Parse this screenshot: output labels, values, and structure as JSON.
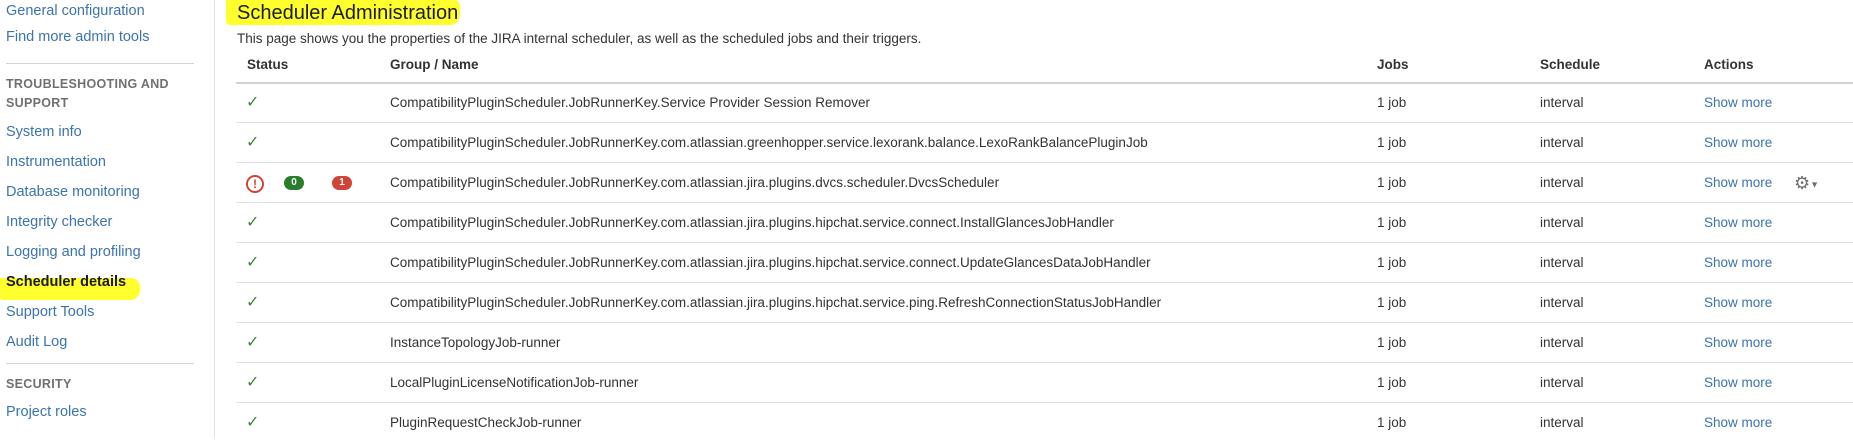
{
  "sidebar": {
    "top_links": [
      "General configuration",
      "Find more admin tools"
    ],
    "troubleshooting_heading_line1": "TROUBLESHOOTING AND",
    "troubleshooting_heading_line2": "SUPPORT",
    "troubleshooting_items": [
      "System info",
      "Instrumentation",
      "Database monitoring",
      "Integrity checker",
      "Logging and profiling",
      "Scheduler details",
      "Support Tools",
      "Audit Log"
    ],
    "security_heading": "SECURITY",
    "security_items": [
      "Project roles"
    ],
    "highlight_color": "#ffff2e"
  },
  "page": {
    "title": "Scheduler Administration",
    "description": "This page shows you the properties of the JIRA internal scheduler, as well as the scheduled jobs and their triggers."
  },
  "table": {
    "headers": {
      "status": "Status",
      "name": "Group / Name",
      "jobs": "Jobs",
      "schedule": "Schedule",
      "actions": "Actions"
    },
    "rows": [
      {
        "status": "ok",
        "name": "CompatibilityPluginScheduler.JobRunnerKey.Service Provider Session Remover",
        "jobs": "1 job",
        "schedule": "interval",
        "action": "Show more"
      },
      {
        "status": "ok",
        "name": "CompatibilityPluginScheduler.JobRunnerKey.com.atlassian.greenhopper.service.lexorank.balance.LexoRankBalancePluginJob",
        "jobs": "1 job",
        "schedule": "interval",
        "action": "Show more"
      },
      {
        "status": "error",
        "success_count": "0",
        "failure_count": "1",
        "name": "CompatibilityPluginScheduler.JobRunnerKey.com.atlassian.jira.plugins.dvcs.scheduler.DvcsScheduler",
        "jobs": "1 job",
        "schedule": "interval",
        "action": "Show more",
        "has_gear_menu": true
      },
      {
        "status": "ok",
        "name": "CompatibilityPluginScheduler.JobRunnerKey.com.atlassian.jira.plugins.hipchat.service.connect.InstallGlancesJobHandler",
        "jobs": "1 job",
        "schedule": "interval",
        "action": "Show more"
      },
      {
        "status": "ok",
        "name": "CompatibilityPluginScheduler.JobRunnerKey.com.atlassian.jira.plugins.hipchat.service.connect.UpdateGlancesDataJobHandler",
        "jobs": "1 job",
        "schedule": "interval",
        "action": "Show more"
      },
      {
        "status": "ok",
        "name": "CompatibilityPluginScheduler.JobRunnerKey.com.atlassian.jira.plugins.hipchat.service.ping.RefreshConnectionStatusJobHandler",
        "jobs": "1 job",
        "schedule": "interval",
        "action": "Show more"
      },
      {
        "status": "ok",
        "name": "InstanceTopologyJob-runner",
        "jobs": "1 job",
        "schedule": "interval",
        "action": "Show more"
      },
      {
        "status": "ok",
        "name": "LocalPluginLicenseNotificationJob-runner",
        "jobs": "1 job",
        "schedule": "interval",
        "action": "Show more"
      },
      {
        "status": "ok",
        "name": "PluginRequestCheckJob-runner",
        "jobs": "1 job",
        "schedule": "interval",
        "action": "Show more"
      }
    ]
  },
  "icons": {
    "ok": "check-icon",
    "error": "error-circle-icon",
    "menu": "gear-icon"
  },
  "colors": {
    "link": "#3b73af",
    "ok": "#3a8a2e",
    "error": "#d04437",
    "success_badge": "#2a7d2b"
  }
}
